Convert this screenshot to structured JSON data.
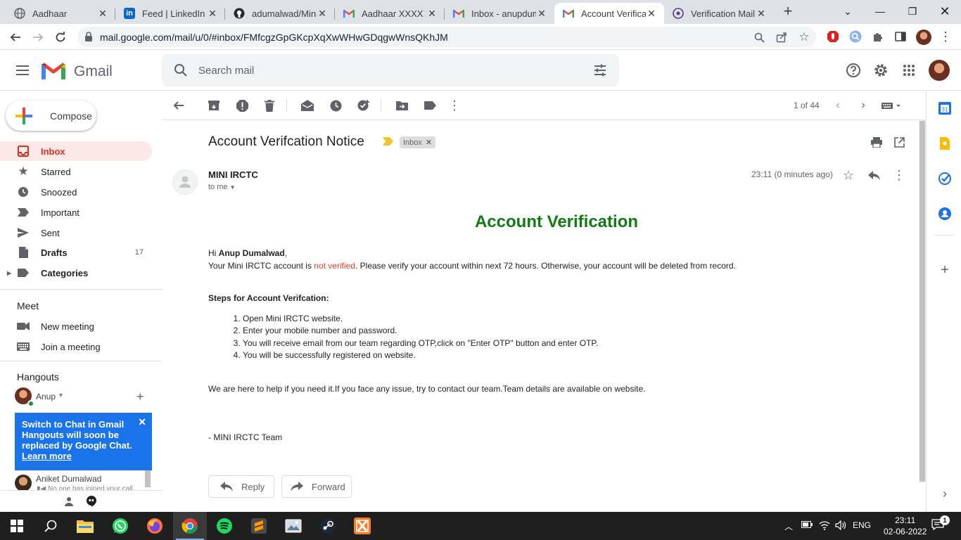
{
  "browser": {
    "tabs": [
      {
        "title": "Aadhaar",
        "icon": "globe-icon"
      },
      {
        "title": "Feed | LinkedIn",
        "icon": "linkedin-icon"
      },
      {
        "title": "adumalwad/Mini",
        "icon": "github-icon"
      },
      {
        "title": "Aadhaar XXXX X",
        "icon": "gmail-icon"
      },
      {
        "title": "Inbox - anupdum",
        "icon": "gmail-icon"
      },
      {
        "title": "Account Verificat",
        "icon": "gmail-icon"
      },
      {
        "title": "Verification Mail",
        "icon": "app-icon"
      }
    ],
    "url": "mail.google.com/mail/u/0/#inbox/FMfcgzGpGKcpXqXwWHwGDqgwWnsQKhJM"
  },
  "gmail": {
    "brand": "Gmail",
    "search_placeholder": "Search mail",
    "compose_label": "Compose",
    "nav": [
      {
        "label": "Inbox",
        "count": "",
        "icon": "inbox-icon"
      },
      {
        "label": "Starred",
        "count": "",
        "icon": "star-icon"
      },
      {
        "label": "Snoozed",
        "count": "",
        "icon": "clock-icon"
      },
      {
        "label": "Important",
        "count": "",
        "icon": "important-icon"
      },
      {
        "label": "Sent",
        "count": "",
        "icon": "send-icon"
      },
      {
        "label": "Drafts",
        "count": "17",
        "icon": "draft-icon"
      },
      {
        "label": "Categories",
        "count": "",
        "icon": "label-icon"
      }
    ],
    "meet": {
      "title": "Meet",
      "new_meeting": "New meeting",
      "join_meeting": "Join a meeting"
    },
    "hangouts": {
      "title": "Hangouts",
      "user": "Anup",
      "promo_title": "Switch to Chat in Gmail",
      "promo_text": "Hangouts will soon be replaced by Google Chat.",
      "promo_link": "Learn more",
      "contact_name": "Aniket Dumalwad",
      "contact_status": "No one has joined your call"
    },
    "pagination": "1 of 44"
  },
  "message": {
    "subject": "Account Verifcation Notice",
    "label": "Inbox",
    "sender": "MINI IRCTC",
    "recipient": "to me",
    "time": "23:11 (0 minutes ago)",
    "heading": "Account Verification",
    "greeting_prefix": "Hi ",
    "greeting_name": "Anup Dumalwad",
    "greeting_suffix": ",",
    "line1_prefix": "Your Mini IRCTC account is ",
    "line1_highlight": "not verified",
    "line1_suffix": ". Please verify your account within next 72 hours. Otherwise, your account will be deleted from record.",
    "steps_title": "Steps for Account Verifcation:",
    "steps": [
      "Open Mini IRCTC website.",
      "Enter your mobile number and password.",
      "You will receive email from our team regarding OTP,click on \"Enter OTP\" button and enter OTP.",
      "You will be successfully registered on website."
    ],
    "help_text": "We are here to help if you need it.If you face any issue, try to contact our team.Team details are available on website.",
    "signature": "- MINI IRCTC Team",
    "reply_label": "Reply",
    "forward_label": "Forward"
  },
  "taskbar": {
    "language": "ENG",
    "time": "23:11",
    "date": "02-06-2022"
  },
  "colors": {
    "gmail_red": "#d93025",
    "verified_green": "#107c10",
    "warning_red": "#d9432f",
    "promo_blue": "#1a73e8"
  }
}
